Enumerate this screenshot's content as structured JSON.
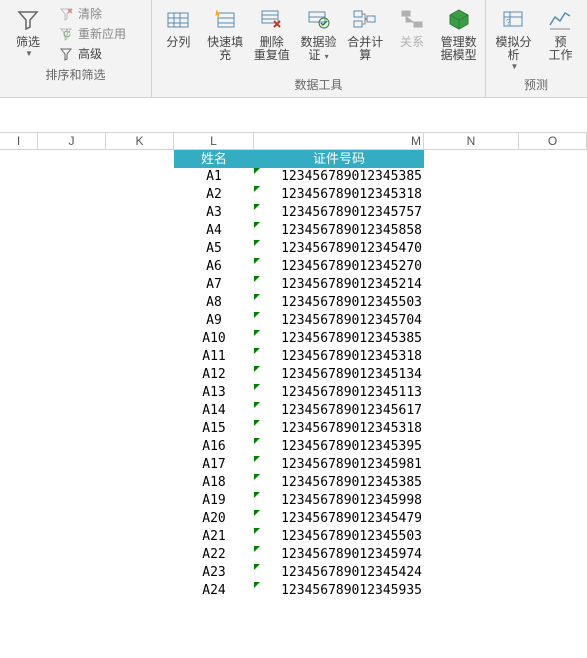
{
  "ribbon": {
    "group1": {
      "filter": "筛选",
      "clear": "清除",
      "reapply": "重新应用",
      "advanced": "高级",
      "label": "排序和筛选"
    },
    "group2": {
      "textToCols": "分列",
      "flashFill": "快速填充",
      "removeDup1": "删除",
      "removeDup2": "重复值",
      "dataVal1": "数据验",
      "dataVal2": "证",
      "consolidate": "合并计算",
      "relations": "关系",
      "manage1": "管理数",
      "manage2": "据模型",
      "label": "数据工具"
    },
    "group3": {
      "whatif": "模拟分析",
      "forecast1": "预",
      "forecast2": "工作",
      "label": "预测"
    }
  },
  "columns": [
    "I",
    "J",
    "K",
    "L",
    "M",
    "N",
    "O"
  ],
  "headers": {
    "L": "姓名",
    "M": "证件号码"
  },
  "rows": [
    {
      "L": "A1",
      "M": "123456789012345385"
    },
    {
      "L": "A2",
      "M": "123456789012345318"
    },
    {
      "L": "A3",
      "M": "123456789012345757"
    },
    {
      "L": "A4",
      "M": "123456789012345858"
    },
    {
      "L": "A5",
      "M": "123456789012345470"
    },
    {
      "L": "A6",
      "M": "123456789012345270"
    },
    {
      "L": "A7",
      "M": "123456789012345214"
    },
    {
      "L": "A8",
      "M": "123456789012345503"
    },
    {
      "L": "A9",
      "M": "123456789012345704"
    },
    {
      "L": "A10",
      "M": "123456789012345385"
    },
    {
      "L": "A11",
      "M": "123456789012345318"
    },
    {
      "L": "A12",
      "M": "123456789012345134"
    },
    {
      "L": "A13",
      "M": "123456789012345113"
    },
    {
      "L": "A14",
      "M": "123456789012345617"
    },
    {
      "L": "A15",
      "M": "123456789012345318"
    },
    {
      "L": "A16",
      "M": "123456789012345395"
    },
    {
      "L": "A17",
      "M": "123456789012345981"
    },
    {
      "L": "A18",
      "M": "123456789012345385"
    },
    {
      "L": "A19",
      "M": "123456789012345998"
    },
    {
      "L": "A20",
      "M": "123456789012345479"
    },
    {
      "L": "A21",
      "M": "123456789012345503"
    },
    {
      "L": "A22",
      "M": "123456789012345974"
    },
    {
      "L": "A23",
      "M": "123456789012345424"
    },
    {
      "L": "A24",
      "M": "123456789012345935"
    }
  ]
}
